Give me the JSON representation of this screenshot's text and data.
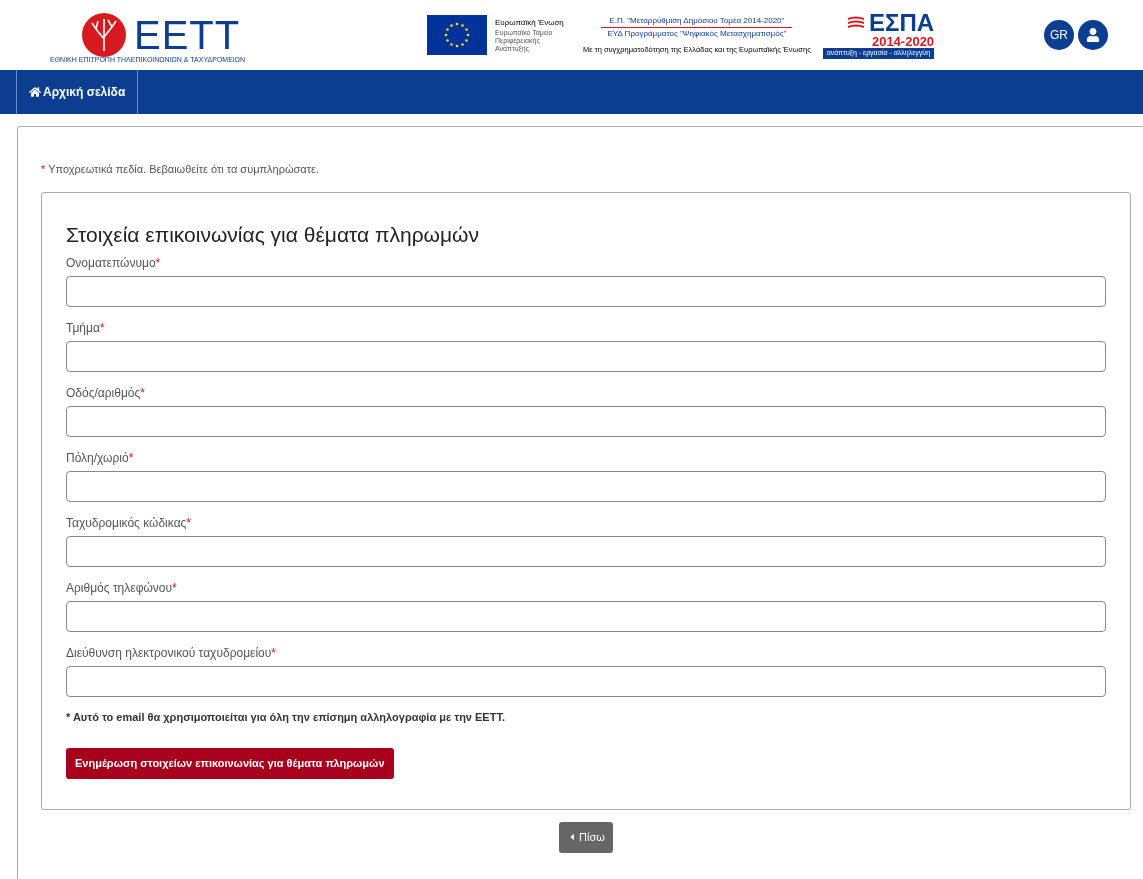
{
  "header": {
    "logo": {
      "wordmark": "ΕΕΤΤ",
      "subtitle": "ΕΘΝΙΚΗ ΕΠΙΤΡΟΠΗ ΤΗΛΕΠΙΚΟΙΝΩΝΙΩΝ & ΤΑΧΥΔΡΟΜΕΙΩΝ"
    },
    "eu": {
      "title": "Ευρωπαϊκή Ένωση",
      "fund": "Ευρωπαϊκό Ταμείο Περιφερειακής Ανάπτυξης"
    },
    "program": {
      "line_1": "Ε.Π. \"Μεταρρύθμιση Δημόσιου Τομέα 2014-2020\"",
      "line_2": "ΕΥΔ Προγράμματος \"Ψηφιακός Μετασχηματισμός\"",
      "line_3": "Με τη συγχρηματοδότηση της Ελλάδας και της Ευρωπαϊκής Ένωσης"
    },
    "espa": {
      "title": "ΕΣΠΑ",
      "years": "2014-2020",
      "motto": "ανάπτυξη - εργασία - αλληλεγγύη"
    },
    "language": "GR"
  },
  "nav": [
    {
      "label": "Αρχική σελίδα"
    }
  ],
  "required_note": {
    "mark": "*",
    "text": "Υποχρεωτικά πεδία. Βεβαιωθείτε ότι τα συμπληρώσατε."
  },
  "form": {
    "title": "Στοιχεία επικοινωνίας για θέματα πληρωμών",
    "fields": [
      {
        "label": "Ονοματεπώνυμο",
        "required": true
      },
      {
        "label": "Τμήμα",
        "required": true
      },
      {
        "label": "Οδός/αριθμός",
        "required": true
      },
      {
        "label": "Πόλη/χωριό",
        "required": true
      },
      {
        "label": "Ταχυδρομικός κώδικας",
        "required": true
      },
      {
        "label": "Αριθμός τηλεφώνου",
        "required": true
      },
      {
        "label": "Διεύθυνση ηλεκτρονικού ταχυδρομείου",
        "required": true
      }
    ],
    "email_note": "* Αυτό το email θα χρησιμοποιείται για όλη την επίσημη αλληλογραφία με την ΕΕΤΤ.",
    "submit": "Ενημέρωση στοιχείων επικοινωνίας για θέματα πληρωμών"
  },
  "back_button": "Πίσω"
}
